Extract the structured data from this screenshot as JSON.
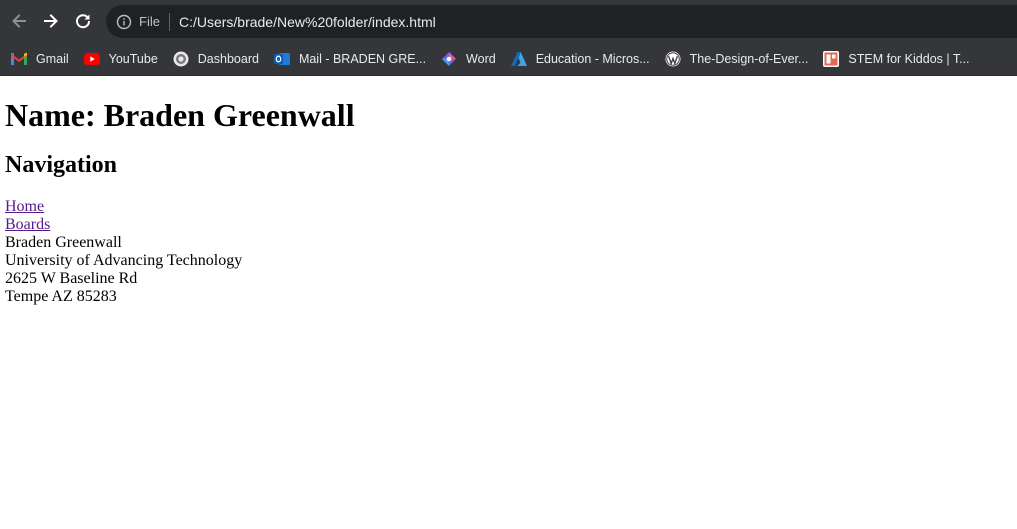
{
  "browser": {
    "scheme_label": "File",
    "url": "C:/Users/brade/New%20folder/index.html",
    "bookmarks": [
      {
        "label": "Gmail",
        "icon": "gmail-icon"
      },
      {
        "label": "YouTube",
        "icon": "youtube-icon"
      },
      {
        "label": "Dashboard",
        "icon": "dashboard-icon"
      },
      {
        "label": "Mail - BRADEN GRE...",
        "icon": "outlook-icon"
      },
      {
        "label": "Word",
        "icon": "word-icon"
      },
      {
        "label": "Education - Micros...",
        "icon": "azure-icon"
      },
      {
        "label": "The-Design-of-Ever...",
        "icon": "wordpress-icon"
      },
      {
        "label": "STEM for Kiddos | T...",
        "icon": "stem-icon"
      }
    ]
  },
  "page": {
    "title": "Name: Braden Greenwall",
    "nav_heading": "Navigation",
    "links": [
      "Home",
      "Boards"
    ],
    "address": [
      "Braden Greenwall",
      "University of Advancing Technology",
      "2625 W Baseline Rd",
      "Tempe AZ 85283"
    ]
  },
  "colors": {
    "toolbar_bg": "#35363a",
    "omnibox_bg": "#202124",
    "visited_link": "#551a8b"
  }
}
